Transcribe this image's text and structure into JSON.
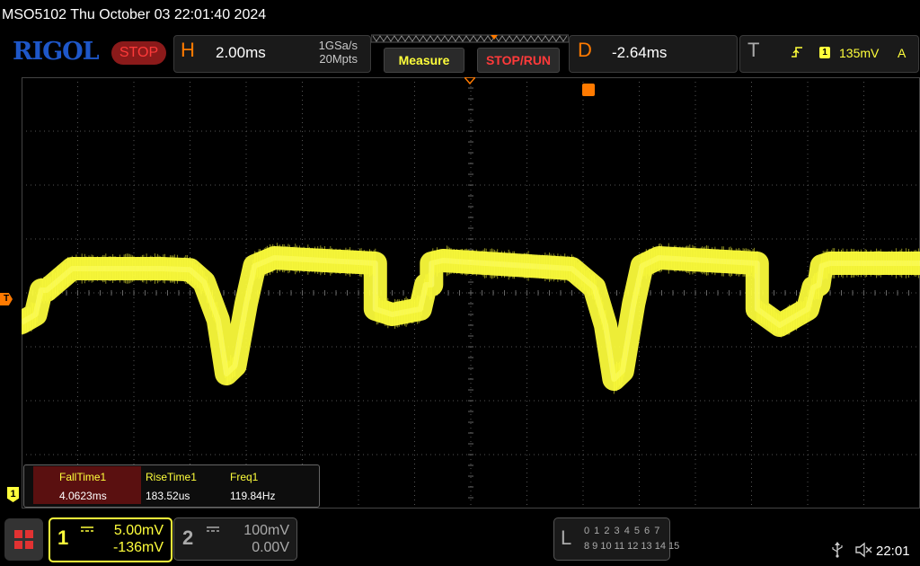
{
  "header": {
    "model_datetime": "MSO5102  Thu October 03 22:01:40 2024"
  },
  "toolbar": {
    "logo": "RIGOL",
    "run_status": "STOP",
    "horizontal": {
      "letter": "H",
      "timebase": "2.00ms",
      "sample_rate": "1GSa/s",
      "memory_depth": "20Mpts"
    },
    "measure_label": "Measure",
    "stoprun_label": "STOP/RUN",
    "delay": {
      "letter": "D",
      "value": "-2.64ms"
    },
    "trigger": {
      "letter": "T",
      "source": "1",
      "level": "135mV",
      "mode": "A",
      "edge_icon": "rising-edge-icon"
    }
  },
  "markers": {
    "trigger_level": "T",
    "ch1_ground": "1"
  },
  "measurements": {
    "items": [
      {
        "name": "FallTime1",
        "value": "4.0623ms"
      },
      {
        "name": "RiseTime1",
        "value": "183.52us"
      },
      {
        "name": "Freq1",
        "value": "119.84Hz"
      }
    ]
  },
  "channels": {
    "ch1": {
      "num": "1",
      "scale": "5.00mV",
      "offset": "-136mV",
      "color": "#ffff3b"
    },
    "ch2": {
      "num": "2",
      "scale": "100mV",
      "offset": "0.00V",
      "color": "#aaaaaa"
    }
  },
  "logic_analyzer": {
    "letter": "L",
    "row1": "0 1 2 3  4 5 6 7",
    "row2": "8 9 10 11 12 13 14 15"
  },
  "status": {
    "clock": "22:01",
    "icons": [
      "usb-icon",
      "sound-off-icon"
    ]
  },
  "colors": {
    "trace": "#ffff3b",
    "accent": "#ff7a00",
    "logo": "#1e57c9",
    "stop": "#ff3a3a"
  },
  "chart_data": {
    "type": "line",
    "title": "",
    "xlabel": "",
    "ylabel": "",
    "series": [
      {
        "x_divisions": [
          0,
          0.25,
          0.35,
          0.45,
          0.9,
          1.4,
          2.5,
          3.0,
          3.25,
          3.5,
          3.65,
          3.8,
          4.0,
          4.15,
          4.5,
          6.3,
          6.3,
          6.6,
          7.1,
          7.2,
          7.3,
          7.3,
          7.5,
          9.8,
          10.2,
          10.4,
          10.55,
          10.7,
          10.9,
          11.05,
          11.35,
          13.1,
          13.1,
          13.5,
          14.0,
          14.1,
          14.2,
          14.25,
          14.4,
          16.0
        ],
        "y_divisions": [
          -0.55,
          -0.4,
          0.05,
          0.05,
          0.45,
          0.45,
          0.45,
          0.43,
          0.2,
          -0.5,
          -1.5,
          -1.35,
          -0.2,
          0.5,
          0.65,
          0.55,
          -0.3,
          -0.4,
          -0.3,
          0.15,
          0.15,
          0.55,
          0.6,
          0.45,
          0.1,
          -0.6,
          -1.6,
          -1.45,
          -0.2,
          0.5,
          0.65,
          0.55,
          -0.3,
          -0.6,
          -0.3,
          0.1,
          0.15,
          0.5,
          0.55,
          0.55
        ]
      }
    ],
    "x_divisions_total": 16,
    "y_divisions_total": 8,
    "grid": true
  }
}
